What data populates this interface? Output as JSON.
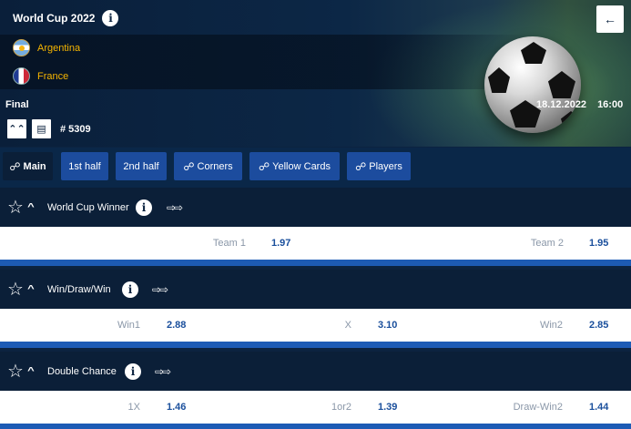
{
  "header": {
    "championship": "World Cup 2022",
    "back_icon": "back-arrow-icon",
    "teams": [
      {
        "name": "Argentina",
        "flag": "argentina-flag-icon"
      },
      {
        "name": "France",
        "flag": "france-flag-icon"
      }
    ],
    "stage": "Final",
    "event_id": "# 5309",
    "date": "18.12.2022",
    "time": "16:00",
    "accent_color": "#f5b400"
  },
  "tabs": [
    {
      "label": "Main",
      "link_icon": true,
      "active": true
    },
    {
      "label": "1st half",
      "link_icon": false,
      "active": false
    },
    {
      "label": "2nd half",
      "link_icon": false,
      "active": false
    },
    {
      "label": "Corners",
      "link_icon": true,
      "active": false
    },
    {
      "label": "Yellow Cards",
      "link_icon": true,
      "active": false
    },
    {
      "label": "Players",
      "link_icon": true,
      "active": false
    }
  ],
  "markets": [
    {
      "title": "World Cup Winner",
      "odds": [
        {
          "label": "Team 1",
          "value": "1.97"
        },
        {
          "label": "Team 2",
          "value": "1.95"
        }
      ]
    },
    {
      "title": "Win/Draw/Win",
      "odds": [
        {
          "label": "Win1",
          "value": "2.88"
        },
        {
          "label": "X",
          "value": "3.10"
        },
        {
          "label": "Win2",
          "value": "2.85"
        }
      ]
    },
    {
      "title": "Double Chance",
      "odds": [
        {
          "label": "1X",
          "value": "1.46"
        },
        {
          "label": "1or2",
          "value": "1.39"
        },
        {
          "label": "Draw-Win2",
          "value": "1.44"
        }
      ]
    }
  ],
  "colors": {
    "background": "#0c2340",
    "tab": "#1c4c9e",
    "odds_value": "#1a4f9c",
    "separator": "#1d5bb5"
  }
}
